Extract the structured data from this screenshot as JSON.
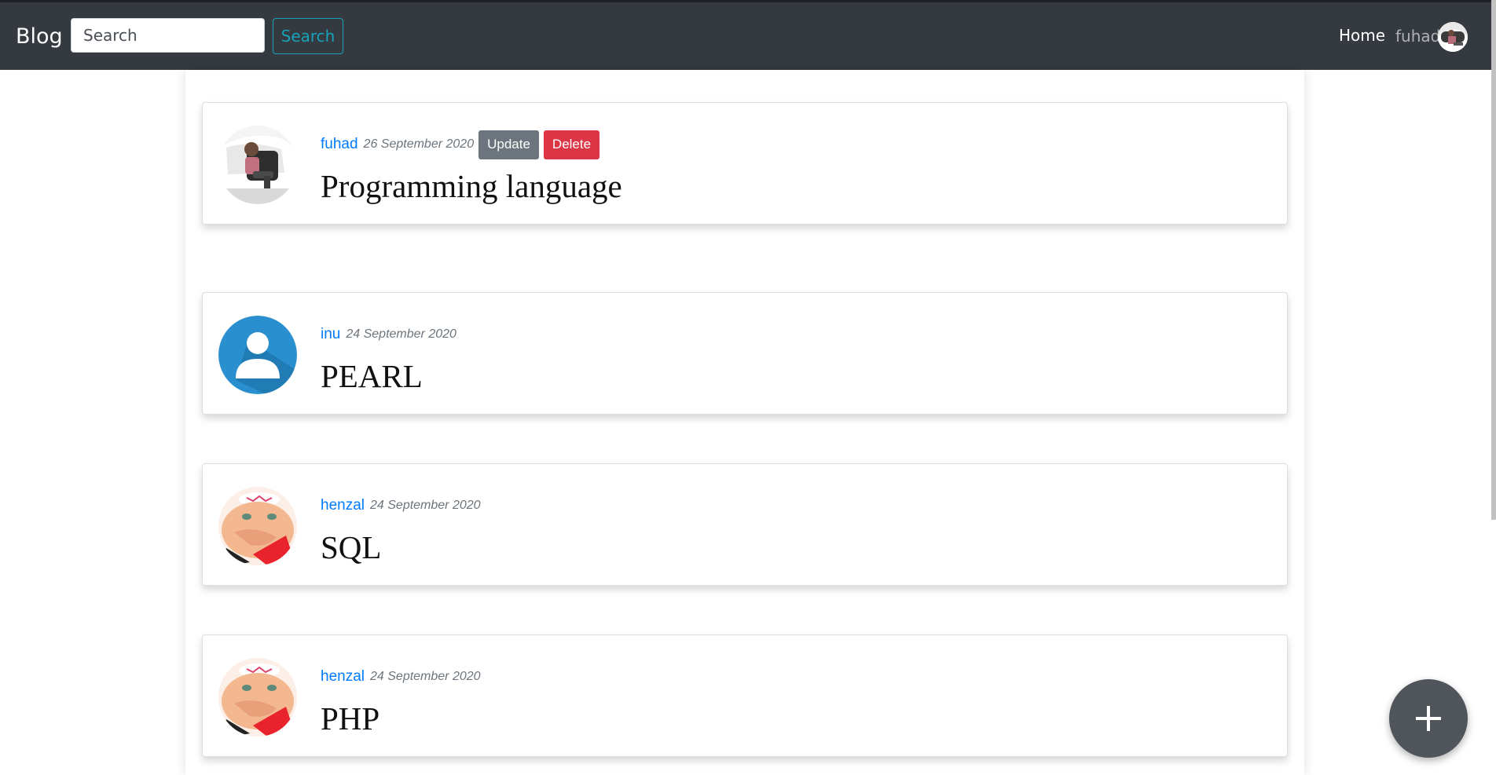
{
  "navbar": {
    "brand": "Blog",
    "search_placeholder": "Search",
    "search_button": "Search",
    "home_link": "Home",
    "username": "fuhad",
    "avatar_icon": "user-photo-avatar"
  },
  "posts": [
    {
      "author": "fuhad",
      "date": "26 September 2020",
      "title": "Programming language",
      "avatar": "photo-person-in-car",
      "update_label": "Update",
      "delete_label": "Delete"
    },
    {
      "author": "inu",
      "date": "24 September 2020",
      "title": "PEARL",
      "avatar": "default-user-icon"
    },
    {
      "author": "henzal",
      "date": "24 September 2020",
      "title": "SQL",
      "avatar": "photo-face-closeup"
    },
    {
      "author": "henzal",
      "date": "24 September 2020",
      "title": "PHP",
      "avatar": "photo-face-closeup"
    }
  ],
  "fab": {
    "icon": "plus-icon"
  },
  "colors": {
    "navbar_bg": "#343a40",
    "accent_info": "#17a2b8",
    "link": "#007bff",
    "secondary": "#6c757d",
    "danger": "#dc3545",
    "avatar_default_bg": "#2a8fce"
  }
}
